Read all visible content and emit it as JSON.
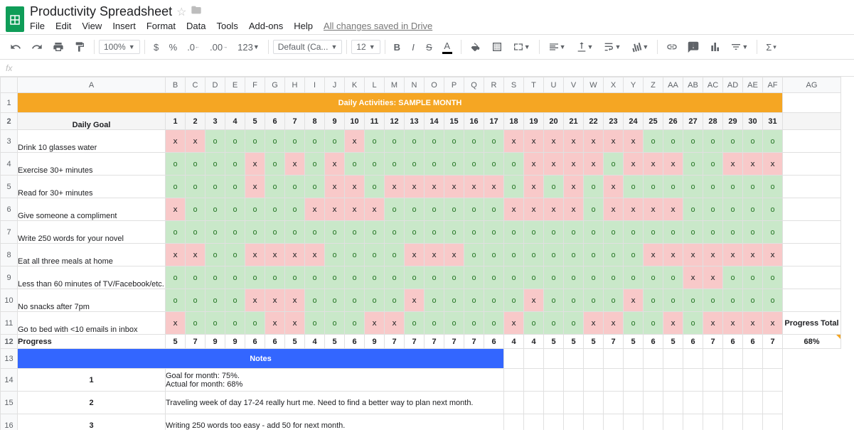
{
  "doc": {
    "title": "Productivity Spreadsheet",
    "saved": "All changes saved in Drive"
  },
  "menu": [
    "File",
    "Edit",
    "View",
    "Insert",
    "Format",
    "Data",
    "Tools",
    "Add-ons",
    "Help"
  ],
  "toolbar": {
    "zoom": "100%",
    "font": "Default (Ca...",
    "size": "12",
    "dollar": "$",
    "percent": "%"
  },
  "fx": "fx",
  "cols": [
    "A",
    "B",
    "C",
    "D",
    "E",
    "F",
    "G",
    "H",
    "I",
    "J",
    "K",
    "L",
    "M",
    "N",
    "O",
    "P",
    "Q",
    "R",
    "S",
    "T",
    "U",
    "V",
    "W",
    "X",
    "Y",
    "Z",
    "AA",
    "AB",
    "AC",
    "AD",
    "AE",
    "AF",
    "AG"
  ],
  "sheet": {
    "title_text": "Daily Activities: SAMPLE MONTH",
    "daily_goal_label": "Daily Goal",
    "days": [
      1,
      2,
      3,
      4,
      5,
      6,
      7,
      8,
      9,
      10,
      11,
      12,
      13,
      14,
      15,
      16,
      17,
      18,
      19,
      20,
      21,
      22,
      23,
      24,
      25,
      26,
      27,
      28,
      29,
      30,
      31
    ],
    "goals": [
      {
        "label": "Drink 10 glasses water",
        "marks": [
          "x",
          "x",
          "o",
          "o",
          "o",
          "o",
          "o",
          "o",
          "o",
          "x",
          "o",
          "o",
          "o",
          "o",
          "o",
          "o",
          "o",
          "x",
          "x",
          "x",
          "x",
          "x",
          "x",
          "x",
          "o",
          "o",
          "o",
          "o",
          "o",
          "o",
          "o"
        ]
      },
      {
        "label": "Exercise 30+ minutes",
        "marks": [
          "o",
          "o",
          "o",
          "o",
          "x",
          "o",
          "x",
          "o",
          "x",
          "o",
          "o",
          "o",
          "o",
          "o",
          "o",
          "o",
          "o",
          "o",
          "x",
          "x",
          "x",
          "x",
          "o",
          "x",
          "x",
          "x",
          "o",
          "o",
          "x",
          "x",
          "x"
        ]
      },
      {
        "label": "Read for 30+ minutes",
        "marks": [
          "o",
          "o",
          "o",
          "o",
          "x",
          "o",
          "o",
          "o",
          "x",
          "x",
          "o",
          "x",
          "x",
          "x",
          "x",
          "x",
          "x",
          "o",
          "x",
          "o",
          "x",
          "o",
          "x",
          "o",
          "o",
          "o",
          "o",
          "o",
          "o",
          "o",
          "o"
        ]
      },
      {
        "label": "Give someone a compliment",
        "marks": [
          "x",
          "o",
          "o",
          "o",
          "o",
          "o",
          "o",
          "x",
          "x",
          "x",
          "x",
          "o",
          "o",
          "o",
          "o",
          "o",
          "o",
          "x",
          "x",
          "x",
          "x",
          "o",
          "x",
          "x",
          "x",
          "x",
          "o",
          "o",
          "o",
          "o",
          "o"
        ]
      },
      {
        "label": "Write 250 words for your novel",
        "marks": [
          "o",
          "o",
          "o",
          "o",
          "o",
          "o",
          "o",
          "o",
          "o",
          "o",
          "o",
          "o",
          "o",
          "o",
          "o",
          "o",
          "o",
          "o",
          "o",
          "o",
          "o",
          "o",
          "o",
          "o",
          "o",
          "o",
          "o",
          "o",
          "o",
          "o",
          "o"
        ]
      },
      {
        "label": "Eat all three meals at home",
        "marks": [
          "x",
          "x",
          "o",
          "o",
          "x",
          "x",
          "x",
          "x",
          "o",
          "o",
          "o",
          "o",
          "x",
          "x",
          "x",
          "o",
          "o",
          "o",
          "o",
          "o",
          "o",
          "o",
          "o",
          "o",
          "x",
          "x",
          "x",
          "x",
          "x",
          "x",
          "x"
        ]
      },
      {
        "label": "Less than 60 minutes of TV/Facebook/etc.",
        "marks": [
          "o",
          "o",
          "o",
          "o",
          "o",
          "o",
          "o",
          "o",
          "o",
          "o",
          "o",
          "o",
          "o",
          "o",
          "o",
          "o",
          "o",
          "o",
          "o",
          "o",
          "o",
          "o",
          "o",
          "o",
          "o",
          "o",
          "x",
          "x",
          "o",
          "o",
          "o"
        ]
      },
      {
        "label": "No snacks after 7pm",
        "marks": [
          "o",
          "o",
          "o",
          "o",
          "x",
          "x",
          "x",
          "o",
          "o",
          "o",
          "o",
          "o",
          "x",
          "o",
          "o",
          "o",
          "o",
          "o",
          "x",
          "o",
          "o",
          "o",
          "o",
          "x",
          "o",
          "o",
          "o",
          "o",
          "o",
          "o",
          "o"
        ]
      },
      {
        "label": "Go to bed with <10 emails in inbox",
        "marks": [
          "x",
          "o",
          "o",
          "o",
          "o",
          "x",
          "x",
          "o",
          "o",
          "o",
          "x",
          "x",
          "o",
          "o",
          "o",
          "o",
          "o",
          "x",
          "o",
          "o",
          "o",
          "x",
          "x",
          "o",
          "o",
          "x",
          "o",
          "x",
          "x",
          "x",
          "x"
        ]
      }
    ],
    "progress_label": "Progress",
    "progress": [
      5,
      7,
      9,
      9,
      6,
      6,
      5,
      4,
      5,
      6,
      9,
      7,
      7,
      7,
      7,
      7,
      6,
      4,
      4,
      5,
      5,
      5,
      7,
      5,
      6,
      5,
      6,
      7,
      6,
      6,
      7
    ],
    "progress_total_label": "Progress Total",
    "percent": "68%",
    "notes_header": "Notes",
    "notes": [
      {
        "n": "1",
        "text1": "Goal for month: 75%.",
        "text2": "Actual for month: 68%"
      },
      {
        "n": "2",
        "text1": "Traveling week of day 17-24 really hurt me. Need to find a better way to plan next month.",
        "text2": ""
      },
      {
        "n": "3",
        "text1": "Writing 250 words too easy - add 50 for next month.",
        "text2": ""
      }
    ]
  }
}
